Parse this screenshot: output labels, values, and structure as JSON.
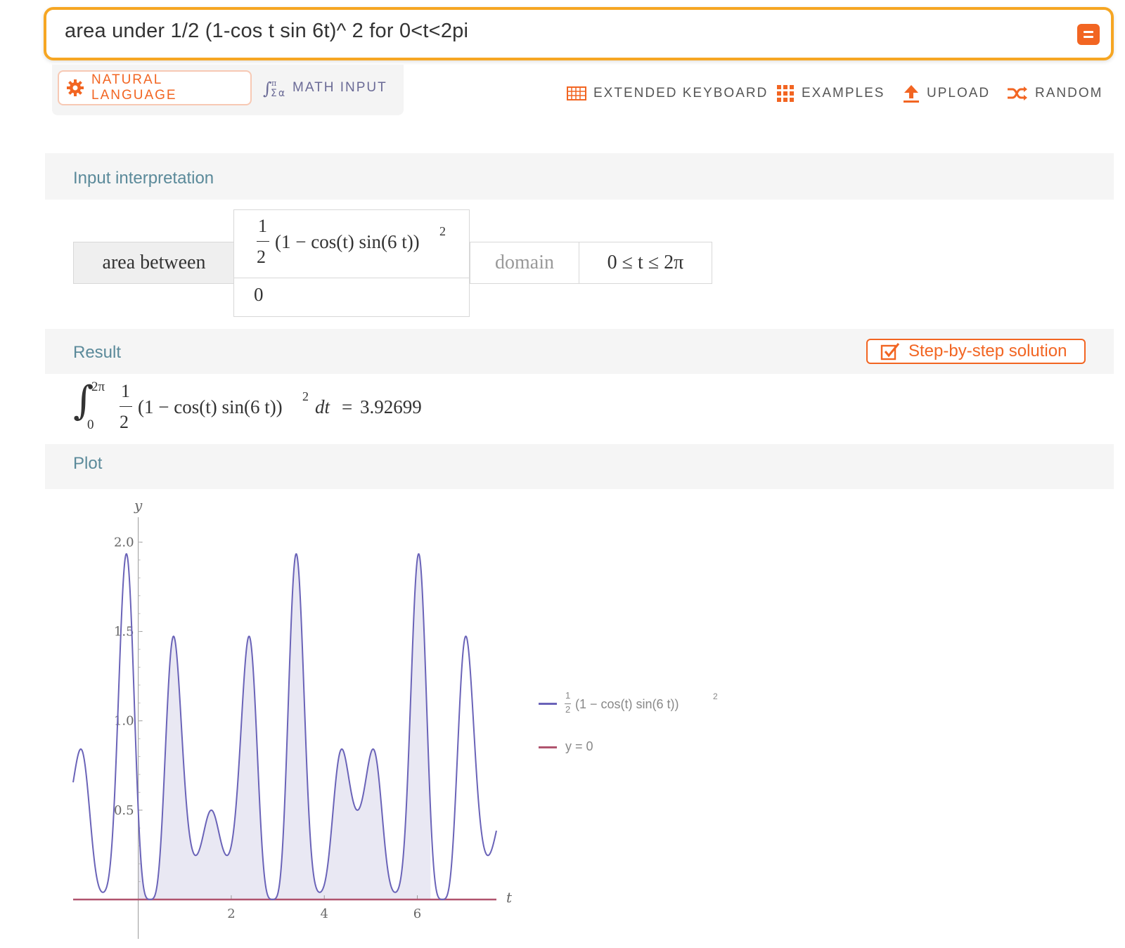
{
  "search": {
    "query": "area under 1/2 (1-cos t sin 6t)^ 2 for 0<t<2pi"
  },
  "input_modes": {
    "natural": "NATURAL LANGUAGE",
    "math": "MATH INPUT"
  },
  "toolbar": {
    "keyboard": "EXTENDED KEYBOARD",
    "examples": "EXAMPLES",
    "upload": "UPLOAD",
    "random": "RANDOM"
  },
  "colors": {
    "accent": "#f26522",
    "query_border": "#f6a623",
    "pod_title": "#5b8a9a",
    "curve": "#6a63b8",
    "baseline": "#b0546e"
  },
  "pods": {
    "input_interpretation": {
      "title": "Input interpretation",
      "area_between": "area between",
      "f_num": "1",
      "f_den": "2",
      "f_body": "(1 − cos(t) sin(6 t))",
      "f_exp": "2",
      "g": "0",
      "domain_label": "domain",
      "domain_value": "0 ≤ t ≤ 2π"
    },
    "result": {
      "title": "Result",
      "step_button": "Step-by-step solution",
      "upper": "2π",
      "lower": "0",
      "f_num": "1",
      "f_den": "2",
      "body": "(1 − cos(t) sin(6 t))",
      "exp": "2",
      "differential": "dt",
      "equals": "=",
      "value": "3.92699"
    },
    "plot": {
      "title": "Plot"
    }
  },
  "chart_data": {
    "type": "line",
    "xlabel": "t",
    "ylabel": "y",
    "xlim": [
      -1.4,
      7.7
    ],
    "ylim": [
      0,
      2.1
    ],
    "x_ticks": [
      "2",
      "4",
      "6"
    ],
    "y_ticks": [
      "0.5",
      "1.0",
      "1.5",
      "2.0"
    ],
    "fill_between": [
      0,
      6.2832
    ],
    "series": [
      {
        "name": "1/2 (1 − cos(t) sin(6 t))^2",
        "function": "0.5*(1-cos(t)*sin(6*t))^2",
        "color": "#6a63b8"
      },
      {
        "name": "y = 0",
        "function": "0",
        "color": "#b0546e"
      }
    ],
    "legend": {
      "entry1_num": "1",
      "entry1_den": "2",
      "entry1_body": "(1 − cos(t) sin(6 t))",
      "entry1_exp": "2",
      "entry2": "y = 0"
    },
    "legend_position": "right"
  }
}
